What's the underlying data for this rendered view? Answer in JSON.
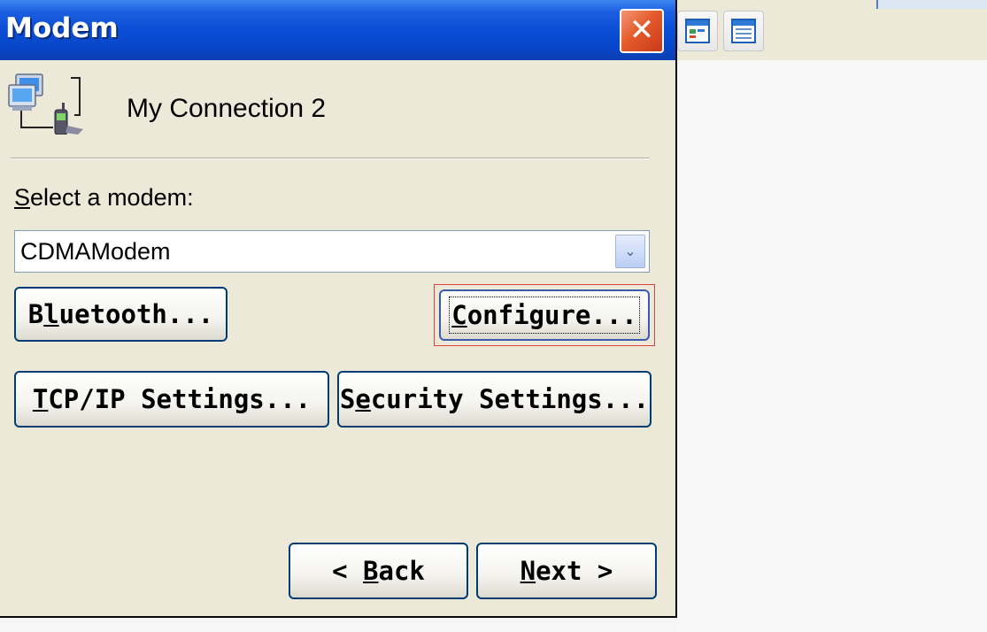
{
  "window": {
    "title": "Modem",
    "close_glyph": "✕"
  },
  "connection": {
    "name": "My Connection 2",
    "icon": "network-computer-phone-icon"
  },
  "modem": {
    "label_accel": "S",
    "label_rest": "elect a modem:",
    "selected": "CDMAModem",
    "dropdown_glyph": "⌄"
  },
  "buttons": {
    "bluetooth": {
      "pre": "B",
      "accel": "l",
      "post": "uetooth..."
    },
    "configure": {
      "pre": "",
      "accel": "C",
      "post": "onfigure..."
    },
    "tcpip": {
      "pre": "",
      "accel": "T",
      "post": "CP/IP Settings..."
    },
    "security": {
      "pre": "S",
      "accel": "e",
      "post": "curity Settings..."
    },
    "back": {
      "pre": "< ",
      "accel": "B",
      "post": "ack"
    },
    "next": {
      "pre": "",
      "accel": "N",
      "post": "ext >"
    }
  },
  "toolbar": {
    "icons": [
      "window-layout-icon",
      "calendar-grid-icon"
    ]
  },
  "colors": {
    "titlebar": "#0a4ed6",
    "dialog_bg": "#ece9d8",
    "button_border": "#003c74",
    "highlight_frame": "#e34040",
    "close_button": "#e55b2c"
  }
}
